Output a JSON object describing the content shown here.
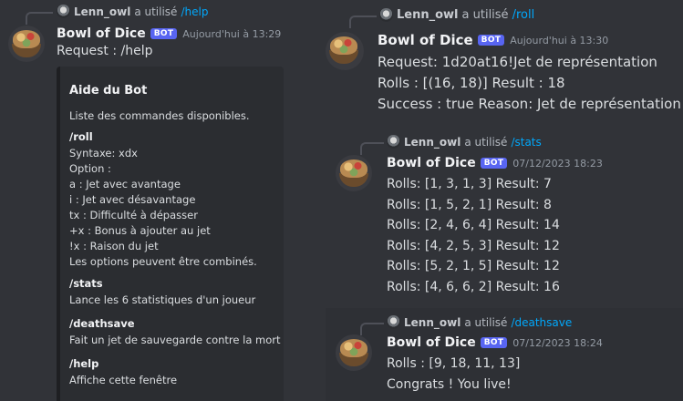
{
  "messages": {
    "help": {
      "reply": {
        "user": "Lenn_owl",
        "verb": "a utilisé",
        "command": "/help"
      },
      "author": "Bowl of Dice",
      "badge": "BOT",
      "timestamp": "Aujourd'hui à 13:29",
      "lines": [
        "Request : /help"
      ],
      "embed": {
        "title": "Aide du Bot",
        "description": "Liste des commandes disponibles.",
        "fields": [
          {
            "name": "/roll",
            "lines": [
              "Syntaxe: xdx",
              "Option :",
              "a : Jet avec avantage",
              "i : Jet avec désavantage",
              "tx : Difficulté à dépasser",
              "+x : Bonus à ajouter au jet",
              "!x : Raison du jet",
              "Les options peuvent être combinés."
            ]
          },
          {
            "name": "/stats",
            "lines": [
              "Lance les 6 statistiques d'un joueur"
            ]
          },
          {
            "name": "/deathsave",
            "lines": [
              "Fait un jet de sauvegarde contre la mort"
            ]
          },
          {
            "name": "/help",
            "lines": [
              "Affiche cette fenêtre"
            ]
          }
        ]
      }
    },
    "roll": {
      "reply": {
        "user": "Lenn_owl",
        "verb": "a utilisé",
        "command": "/roll"
      },
      "author": "Bowl of Dice",
      "badge": "BOT",
      "timestamp": "Aujourd'hui à 13:30",
      "lines": [
        "Request: 1d20at16!Jet de représentation",
        "Rolls : [(16, 18)] Result : 18",
        "Success : true Reason: Jet de représentation"
      ]
    },
    "stats": {
      "reply": {
        "user": "Lenn_owl",
        "verb": "a utilisé",
        "command": "/stats"
      },
      "author": "Bowl of Dice",
      "badge": "BOT",
      "timestamp": "07/12/2023 18:23",
      "lines": [
        "Rolls: [1, 3, 1, 3] Result: 7",
        "Rolls: [1, 5, 2, 1] Result: 8",
        "Rolls: [2, 4, 6, 4] Result: 14",
        "Rolls: [4, 2, 5, 3] Result: 12",
        "Rolls: [5, 2, 1, 5] Result: 12",
        "Rolls: [4, 6, 6, 2] Result: 16"
      ]
    },
    "deathsave": {
      "reply": {
        "user": "Lenn_owl",
        "verb": "a utilisé",
        "command": "/deathsave"
      },
      "author": "Bowl of Dice",
      "badge": "BOT",
      "timestamp": "07/12/2023 18:24",
      "lines": [
        "Rolls : [9, 18, 11, 13]",
        "Congrats ! You live!"
      ]
    }
  },
  "colors": {
    "background": "#313338",
    "command_link": "#00a8fc",
    "bot_badge": "#5865f2",
    "embed": "#2b2d31"
  },
  "icons": {
    "author_avatar": "bowl-of-dice-avatar",
    "reply_avatar": "lenn-owl-avatar"
  }
}
